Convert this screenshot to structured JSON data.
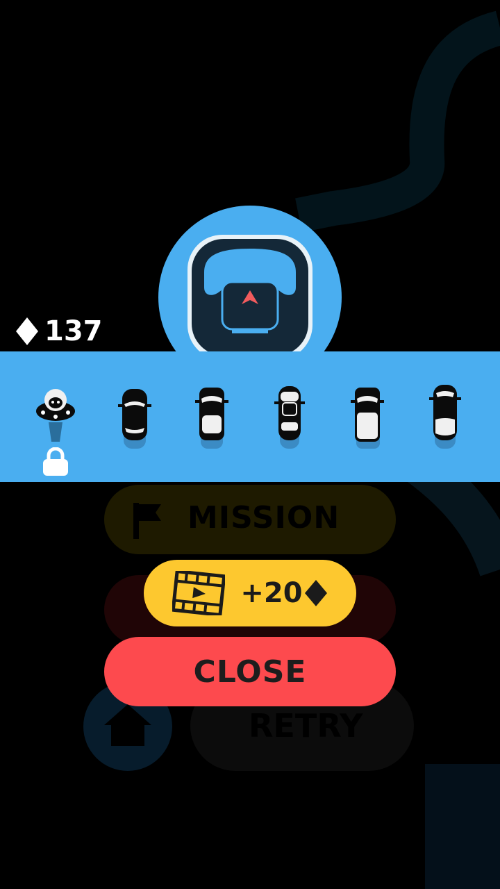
{
  "gems": {
    "count": "137",
    "icon": "diamond-icon"
  },
  "featured": {
    "icon": "steering-wheel-icon"
  },
  "cars": [
    {
      "name": "ufo",
      "locked": true
    },
    {
      "name": "car-2",
      "locked": false
    },
    {
      "name": "car-3",
      "locked": false
    },
    {
      "name": "car-4",
      "locked": false
    },
    {
      "name": "car-5",
      "locked": false
    },
    {
      "name": "car-6",
      "locked": false
    }
  ],
  "background": {
    "mission_label": "MISSION",
    "retry_label": "RETRY"
  },
  "reward": {
    "label": "+20",
    "icon": "video-film-icon",
    "currency_icon": "diamond-icon"
  },
  "close": {
    "label": "CLOSE"
  },
  "colors": {
    "bar_blue": "#4aaef0",
    "reward_yellow": "#fdc82f",
    "close_red": "#fd4a4e",
    "wheel_dark": "#142838"
  }
}
